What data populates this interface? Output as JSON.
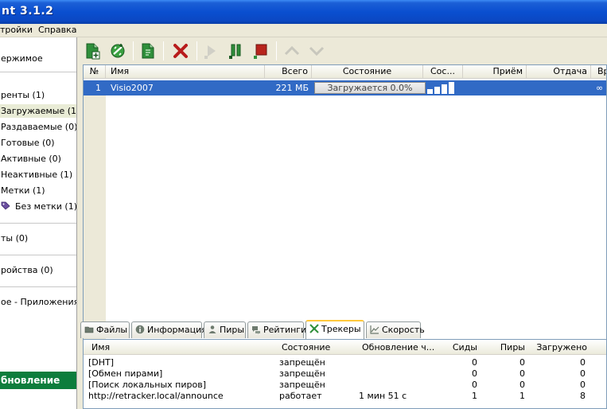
{
  "window": {
    "title": "nt 3.1.2"
  },
  "menu": {
    "items": [
      "тройки",
      "Справка"
    ]
  },
  "sidebar": {
    "items": [
      {
        "label": "ержимое"
      },
      {
        "label": "ренты (1)"
      },
      {
        "label": "Загружаемые (1)"
      },
      {
        "label": "Раздаваемые (0)"
      },
      {
        "label": "Готовые (0)"
      },
      {
        "label": "Активные (0)"
      },
      {
        "label": "Неактивные (1)"
      },
      {
        "label": "Метки (1)"
      },
      {
        "label": "Без метки (1)"
      },
      {
        "label": "ты (0)"
      },
      {
        "label": "ройства (0)"
      },
      {
        "label": "ое - Приложения!"
      }
    ],
    "update_label": "бновление"
  },
  "toolbar": {
    "icons": [
      "add-torrent-icon",
      "add-link-icon",
      "create-torrent-icon",
      "remove-icon",
      "start-icon",
      "pause-icon",
      "stop-icon",
      "move-up-icon",
      "move-down-icon"
    ]
  },
  "torrent_list": {
    "columns": [
      "№",
      "Имя",
      "Всего",
      "Состояние",
      "Сос...",
      "Приём",
      "Отдача",
      "Вр"
    ],
    "rows": [
      {
        "num": "1",
        "name": "Visio2007",
        "size": "221 МБ",
        "status": "Загружается 0.0%",
        "availability": [
          0.4,
          0.6,
          0.8,
          1.0
        ],
        "down": "",
        "up": "",
        "eta": "∞"
      }
    ]
  },
  "tabs": [
    {
      "label": "Файлы"
    },
    {
      "label": "Информация"
    },
    {
      "label": "Пиры"
    },
    {
      "label": "Рейтинги"
    },
    {
      "label": "Трекеры"
    },
    {
      "label": "Скорость"
    }
  ],
  "trackers": {
    "columns": [
      "Имя",
      "Состояние",
      "Обновление ч...",
      "Сиды",
      "Пиры",
      "Загружено"
    ],
    "rows": [
      {
        "name": "[DHT]",
        "status": "запрещён",
        "update": "",
        "seeds": "0",
        "peers": "0",
        "downloaded": "0"
      },
      {
        "name": "[Обмен пирами]",
        "status": "запрещён",
        "update": "",
        "seeds": "0",
        "peers": "0",
        "downloaded": "0"
      },
      {
        "name": "[Поиск локальных пиров]",
        "status": "запрещён",
        "update": "",
        "seeds": "0",
        "peers": "0",
        "downloaded": "0"
      },
      {
        "name": "http://retracker.local/announce",
        "status": "работает",
        "update": "1 мин 51 с",
        "seeds": "1",
        "peers": "1",
        "downloaded": "8"
      }
    ]
  },
  "colors": {
    "titlebar": "#0a4fd0",
    "selection": "#316ac5",
    "update_bar": "#0d7d3c",
    "active_tab_accent": "#ffc83c"
  }
}
